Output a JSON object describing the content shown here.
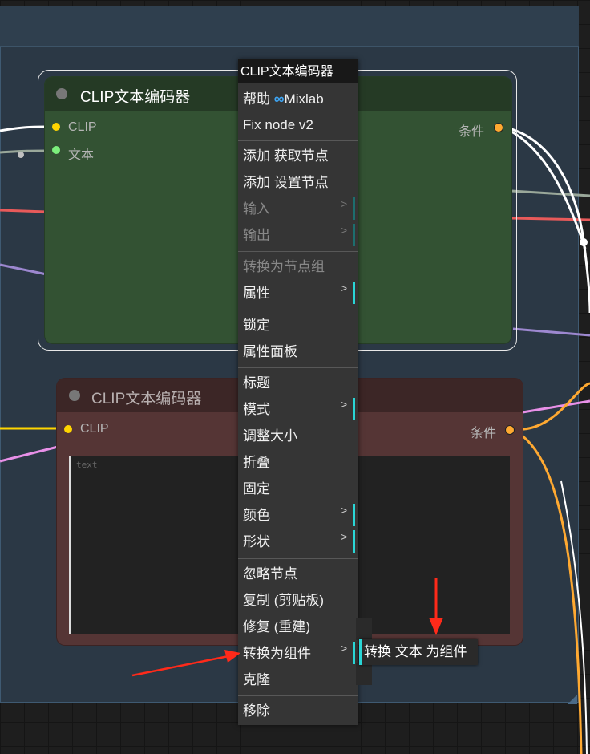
{
  "colors": {
    "canvas": "#1e1e1e",
    "group": "#2b3845",
    "green_node": "#335233",
    "red_node": "#553535",
    "menu": "#353535",
    "submenu_accent": "#2ad5d5",
    "arrow": "#ff2a1a",
    "clip_slot": "#ffd500",
    "text_slot": "#7cf07c",
    "condition_slot": "#ffa931"
  },
  "node_selected": {
    "title": "CLIP文本编码器",
    "inputs": [
      "CLIP",
      "文本"
    ],
    "output": "条件"
  },
  "node_bypassed": {
    "title": "CLIP文本编码器",
    "input": "CLIP",
    "output": "条件",
    "textarea_placeholder": "text"
  },
  "context_menu": {
    "title": "CLIP文本编码器",
    "help_label": "帮助",
    "help_icon": "infinity-icon",
    "help_brand": "Mixlab",
    "fix_node": "Fix node v2",
    "add_get_node": "添加 获取节点",
    "add_set_node": "添加 设置节点",
    "inputs": "输入",
    "outputs": "输出",
    "convert_to_group_node": "转换为节点组",
    "properties": "属性",
    "pin": "锁定",
    "properties_panel": "属性面板",
    "title_item": "标题",
    "mode": "模式",
    "resize": "调整大小",
    "collapse": "折叠",
    "pin_item": "固定",
    "colors_item": "颜色",
    "shapes": "形状",
    "bypass": "忽略节点",
    "copy_clipspace": "复制 (剪贴板)",
    "fix_recreate": "修复 (重建)",
    "convert_to_widget": "转换为组件",
    "clone": "克隆",
    "remove": "移除",
    "submenu_arrow": ">"
  },
  "submenu": {
    "convert_text_to_widget": "转换 文本 为组件"
  }
}
